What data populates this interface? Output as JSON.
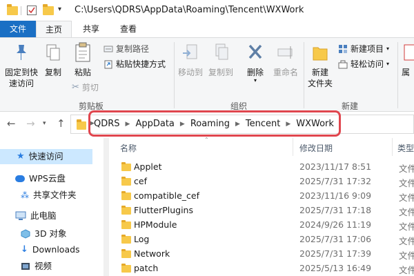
{
  "window": {
    "title_path": "C:\\Users\\QDRS\\AppData\\Roaming\\Tencent\\WXWork"
  },
  "tabs": [
    {
      "label": "文件"
    },
    {
      "label": "主页"
    },
    {
      "label": "共享"
    },
    {
      "label": "查看"
    }
  ],
  "ribbon": {
    "pin_quick_access": {
      "line1": "固定到快",
      "line2": "速访问"
    },
    "copy": "复制",
    "paste": "粘贴",
    "copy_path": "复制路径",
    "paste_shortcut": "粘贴快捷方式",
    "cut": "剪切",
    "clipboard_group": "剪贴板",
    "move_to": "移动到",
    "copy_to": "复制到",
    "delete": "删除",
    "rename": "重命名",
    "organize_group": "组织",
    "new_folder": {
      "line1": "新建",
      "line2": "文件夹"
    },
    "new_item": "新建项目",
    "easy_access": "轻松访问",
    "new_group": "新建",
    "properties_partial": "属"
  },
  "address": {
    "breadcrumbs": [
      "QDRS",
      "AppData",
      "Roaming",
      "Tencent",
      "WXWork"
    ]
  },
  "navpane": {
    "items": [
      {
        "label": "快速访问",
        "icon": "star-icon"
      },
      {
        "label": "WPS云盘",
        "icon": "cloud-icon"
      },
      {
        "label": "共享文件夹",
        "icon": "share-icon"
      },
      {
        "label": "此电脑",
        "icon": "computer-icon"
      },
      {
        "label": "3D 对象",
        "icon": "cube-icon"
      },
      {
        "label": "Downloads",
        "icon": "download-icon"
      },
      {
        "label": "视频",
        "icon": "video-icon"
      }
    ]
  },
  "filelist": {
    "columns": {
      "name": "名称",
      "modified": "修改日期",
      "type": "类型"
    },
    "rows": [
      {
        "name": "Applet",
        "modified": "2023/11/17 8:51",
        "type": "文件"
      },
      {
        "name": "cef",
        "modified": "2025/7/31 17:32",
        "type": "文件"
      },
      {
        "name": "compatible_cef",
        "modified": "2023/11/16 9:09",
        "type": "文件"
      },
      {
        "name": "FlutterPlugins",
        "modified": "2025/7/31 17:18",
        "type": "文件"
      },
      {
        "name": "HPModule",
        "modified": "2024/9/26 11:19",
        "type": "文件"
      },
      {
        "name": "Log",
        "modified": "2025/7/31 17:06",
        "type": "文件"
      },
      {
        "name": "Network",
        "modified": "2025/7/31 17:39",
        "type": "文件"
      },
      {
        "name": "patch",
        "modified": "2025/5/13 16:49",
        "type": "文件"
      }
    ]
  },
  "colors": {
    "accent": "#1a6fc4",
    "folder": "#f7c94a",
    "highlight": "#e0464e",
    "selected": "#cce8ff"
  }
}
